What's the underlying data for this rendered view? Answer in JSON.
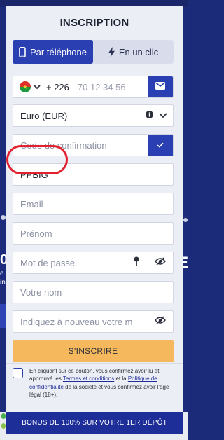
{
  "background": {
    "left_big_text": "0",
    "left_small_lines": [
      "e",
      "in"
    ],
    "right_big_text": "E"
  },
  "modal": {
    "title": "INSCRIPTION",
    "tabs": [
      {
        "label": "Par téléphone",
        "icon": "phone-icon",
        "active": true
      },
      {
        "label": "En un clic",
        "icon": "lightning-icon",
        "active": false
      }
    ],
    "phone": {
      "country_code": "+ 226",
      "placeholder": "70 12 34 56",
      "flag": "burkina-faso-flag-icon"
    },
    "currency": {
      "value": "Euro (EUR)"
    },
    "confirmation_code": {
      "placeholder": "Code de confirmation"
    },
    "promo_code": {
      "value": "PPBIG"
    },
    "email": {
      "placeholder": "Email"
    },
    "first_name": {
      "placeholder": "Prénom"
    },
    "password": {
      "placeholder": "Mot de passe"
    },
    "last_name": {
      "placeholder": "Votre nom"
    },
    "repeat_password": {
      "placeholder": "Indiquez à nouveau votre m"
    },
    "submit_label": "S'INSCRIRE",
    "consent": {
      "part1": "En cliquant sur ce bouton, vous confirmez avoir lu et approuvé les ",
      "terms_link": "Termes et conditions",
      "part2": " et la ",
      "privacy_link": "Politique de confidentialité",
      "part3": " de la société et vous confirmez avoir l'âge légal (18+)."
    },
    "bonus_banner": "BONUS DE 100% SUR VOTRE 1ER DÉPÔT"
  },
  "colors": {
    "primary": "#2a3fb2",
    "submit": "#f6b85c",
    "highlight_circle": "#e3202d",
    "background": "#1d2b7d"
  }
}
